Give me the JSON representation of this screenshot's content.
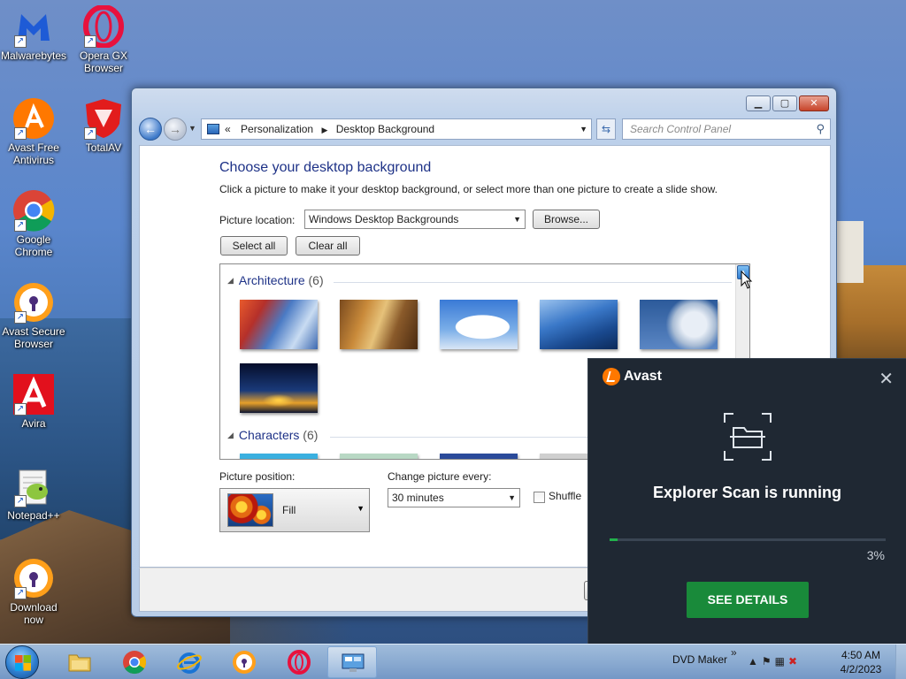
{
  "desktop_icons": [
    {
      "label": "Malwarebytes"
    },
    {
      "label": "Opera GX Browser"
    },
    {
      "label": "Avast Free Antivirus"
    },
    {
      "label": "TotalAV"
    },
    {
      "label": "Google Chrome"
    },
    {
      "label": "Avast Secure Browser"
    },
    {
      "label": "Avira"
    },
    {
      "label": "Notepad++"
    },
    {
      "label": "Download now"
    }
  ],
  "window": {
    "breadcrumb": [
      "Personalization",
      "Desktop Background"
    ],
    "breadcrumb_prefix": "«",
    "search_placeholder": "Search Control Panel",
    "heading": "Choose your desktop background",
    "subheading": "Click a picture to make it your desktop background, or select more than one picture to create a slide show.",
    "picture_location_label": "Picture location:",
    "picture_location_value": "Windows Desktop Backgrounds",
    "browse_label": "Browse...",
    "select_all_label": "Select all",
    "clear_all_label": "Clear all",
    "groups": [
      {
        "name": "Architecture",
        "count": "(6)"
      },
      {
        "name": "Characters",
        "count": "(6)"
      }
    ],
    "picture_position_label": "Picture position:",
    "picture_position_value": "Fill",
    "change_every_label": "Change picture every:",
    "change_every_value": "30 minutes",
    "shuffle_label": "Shuffle"
  },
  "avast": {
    "brand": "Avast",
    "title": "Explorer Scan is running",
    "progress_percent": 3,
    "progress_label": "3%",
    "details_button": "SEE DETAILS"
  },
  "taskbar": {
    "tray_label": "DVD Maker",
    "tray_chevron": "»",
    "time": "4:50 AM",
    "date": "4/2/2023"
  },
  "colors": {
    "avast_bg": "#1f2833",
    "avast_green": "#198a3a",
    "avast_orange": "#ff7800",
    "heading_blue": "#1e3287"
  }
}
